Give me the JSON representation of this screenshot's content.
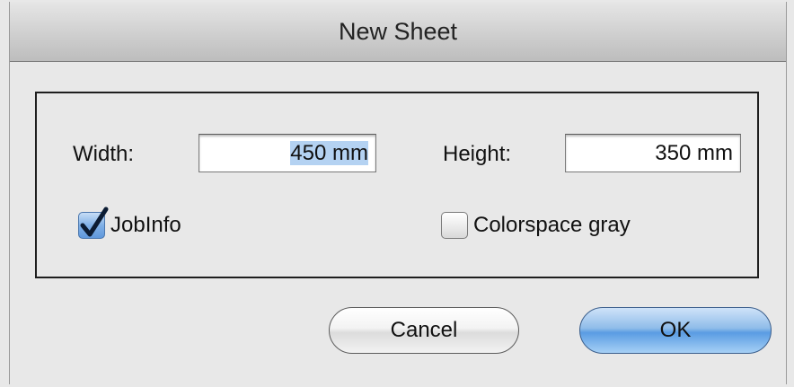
{
  "dialog": {
    "title": "New Sheet"
  },
  "fields": {
    "width_label": "Width:",
    "width_value": "450 mm",
    "height_label": "Height:",
    "height_value": "350 mm"
  },
  "options": {
    "jobinfo_label": "JobInfo",
    "jobinfo_checked": true,
    "colorspace_label": "Colorspace gray",
    "colorspace_checked": false
  },
  "buttons": {
    "cancel_label": "Cancel",
    "ok_label": "OK"
  },
  "colors": {
    "selection_highlight": "#b4d2f2",
    "default_button": "#5a9ce3"
  }
}
